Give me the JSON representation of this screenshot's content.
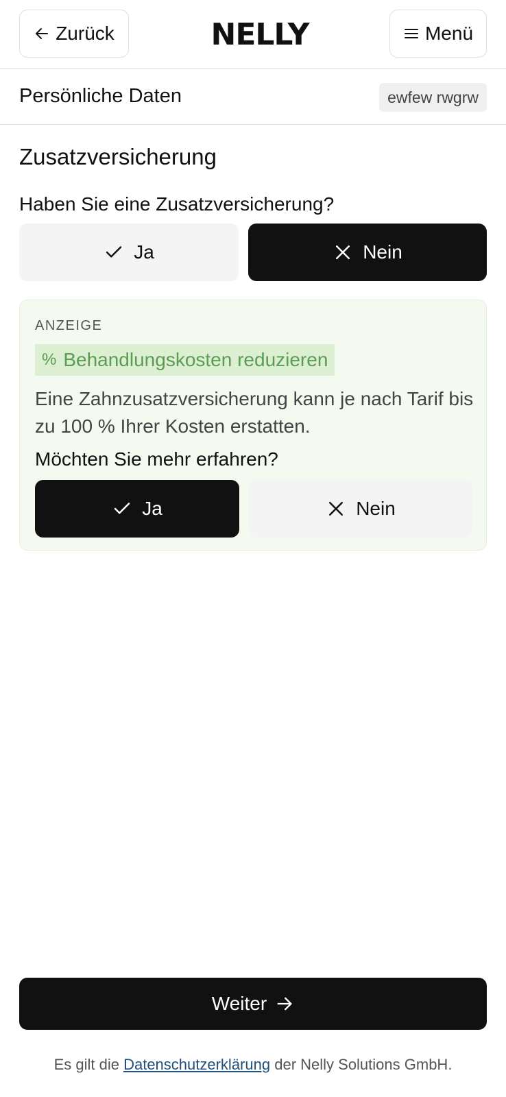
{
  "header": {
    "back_label": "Zurück",
    "logo_text": "NELLY",
    "menu_label": "Menü"
  },
  "subheader": {
    "title": "Persönliche Daten",
    "name_badge": "ewfew rwgrw"
  },
  "section": {
    "title": "Zusatzversicherung",
    "question": "Haben Sie eine Zusatzversicherung?",
    "options": [
      {
        "label": "Ja",
        "icon": "check-icon",
        "selected": false
      },
      {
        "label": "Nein",
        "icon": "close-icon",
        "selected": true
      }
    ]
  },
  "ad": {
    "label": "ANZEIGE",
    "highlight_icon": "%",
    "highlight": "Behandlungskosten reduzieren",
    "text": "Eine Zahnzusatzversicherung kann je nach Tarif bis zu 100 % Ihrer Kosten erstatten.",
    "question": "Möchten Sie mehr erfahren?",
    "options": [
      {
        "label": "Ja",
        "icon": "check-icon",
        "selected": true
      },
      {
        "label": "Nein",
        "icon": "close-icon",
        "selected": false
      }
    ],
    "background_color": "#f5faf1",
    "highlight_color": "#5b9c52"
  },
  "footer": {
    "next_label": "Weiter",
    "privacy_prefix": "Es gilt die",
    "privacy_link": "Datenschutzerklärung",
    "privacy_suffix": "der Nelly Solutions GmbH."
  }
}
